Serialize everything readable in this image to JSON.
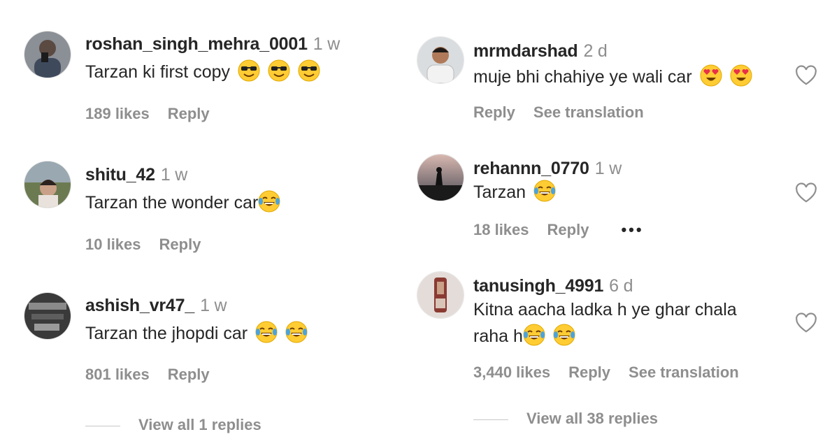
{
  "left": {
    "comments": [
      {
        "username": "roshan_singh_mehra_0001",
        "time": "1 w",
        "text": "Tarzan ki first copy",
        "emojis": [
          "smiling-sunglasses",
          "smiling-sunglasses",
          "smiling-sunglasses"
        ],
        "likes": "189 likes",
        "reply": "Reply"
      },
      {
        "username": "shitu_42",
        "time": "1 w",
        "text": "Tarzan the wonder car",
        "emojis": [
          "tears-of-joy"
        ],
        "likes": "10 likes",
        "reply": "Reply"
      },
      {
        "username": "ashish_vr47_",
        "time": "1 w",
        "text": "Tarzan the jhopdi car",
        "emojis": [
          "tears-of-joy",
          "tears-of-joy"
        ],
        "likes": "801 likes",
        "reply": "Reply"
      }
    ],
    "view_all": "View all 1 replies"
  },
  "right": {
    "comments": [
      {
        "username": "mrmdarshad",
        "time": "2 d",
        "text": "muje bhi chahiye ye wali car",
        "emojis": [
          "heart-eyes",
          "heart-eyes"
        ],
        "reply": "Reply",
        "translation": "See translation"
      },
      {
        "username": "rehannn_0770",
        "time": "1 w",
        "text": "Tarzan",
        "emojis": [
          "tears-of-joy"
        ],
        "likes": "18 likes",
        "reply": "Reply",
        "more": "•••"
      },
      {
        "username": "tanusingh_4991",
        "time": "6 d",
        "text_line1": "Kitna aacha ladka h ye ghar chala",
        "text_line2": "raha h",
        "emojis": [
          "tears-of-joy",
          "tears-of-joy"
        ],
        "likes": "3,440 likes",
        "reply": "Reply",
        "translation": "See translation"
      }
    ],
    "view_all": "View all 38 replies"
  }
}
